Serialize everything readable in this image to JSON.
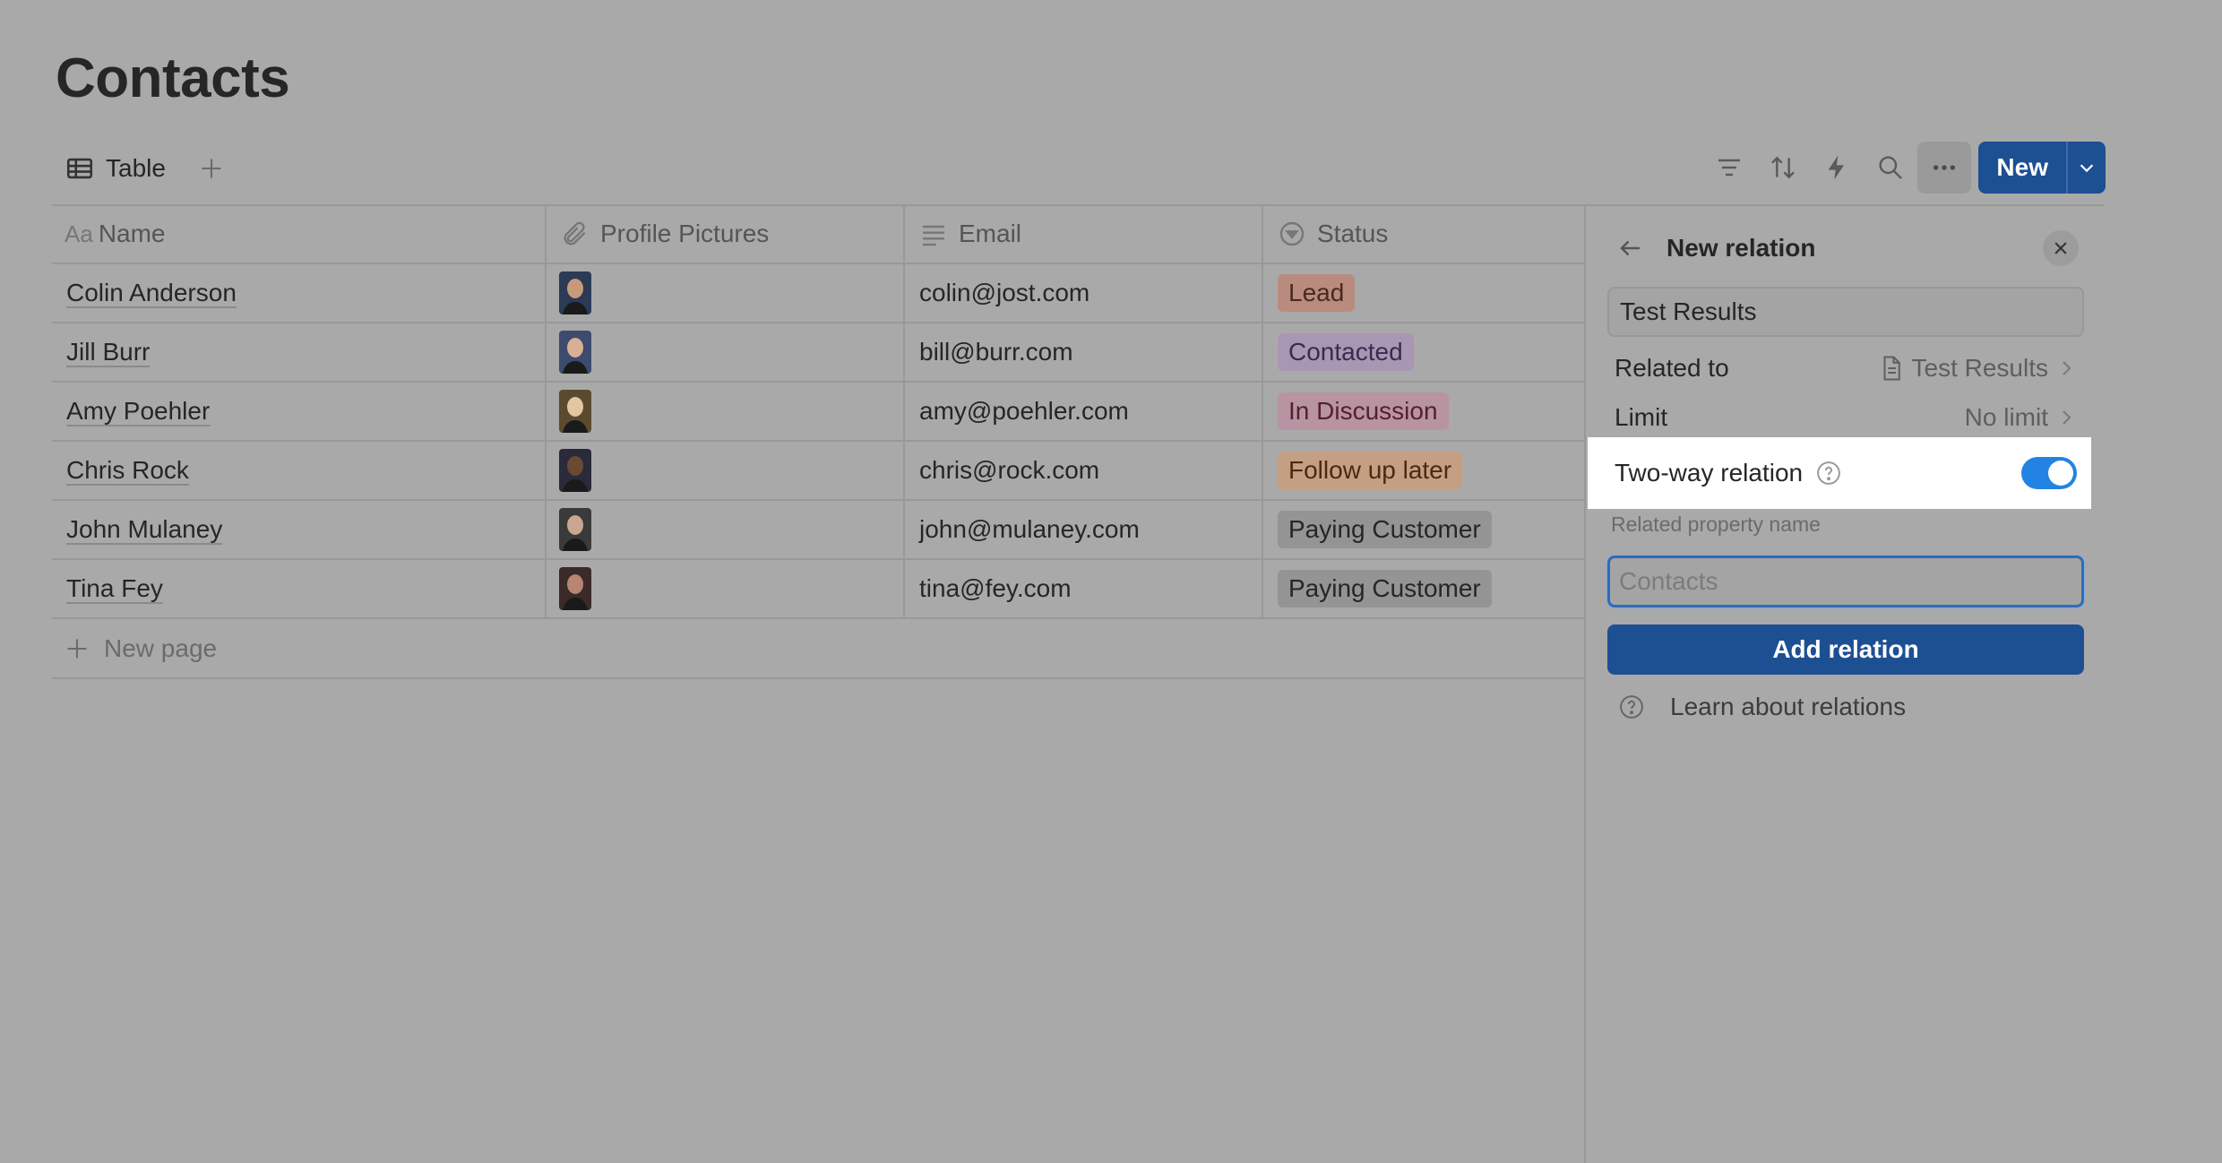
{
  "page": {
    "title": "Contacts"
  },
  "view": {
    "tab_label": "Table"
  },
  "toolbar": {
    "new_label": "New"
  },
  "columns": [
    {
      "label": "Name",
      "icon": "text-icon"
    },
    {
      "label": "Profile Pictures",
      "icon": "paperclip-icon"
    },
    {
      "label": "Email",
      "icon": "text-lines-icon"
    },
    {
      "label": "Status",
      "icon": "status-icon"
    }
  ],
  "rows": [
    {
      "name": "Colin Anderson",
      "email": "colin@jost.com",
      "status": "Lead",
      "status_color": "#b98b7f",
      "status_text": "#4a2a1f"
    },
    {
      "name": "Jill Burr",
      "email": "bill@burr.com",
      "status": "Contacted",
      "status_color": "#a897b3",
      "status_text": "#3e2950"
    },
    {
      "name": "Amy Poehler",
      "email": "amy@poehler.com",
      "status": "In Discussion",
      "status_color": "#b893a2",
      "status_text": "#55202e"
    },
    {
      "name": "Chris Rock",
      "email": "chris@rock.com",
      "status": "Follow up later",
      "status_color": "#c59f82",
      "status_text": "#4a2a12"
    },
    {
      "name": "John Mulaney",
      "email": "john@mulaney.com",
      "status": "Paying Customer",
      "status_color": "#949494",
      "status_text": "#262626"
    },
    {
      "name": "Tina Fey",
      "email": "tina@fey.com",
      "status": "Paying Customer",
      "status_color": "#949494",
      "status_text": "#262626"
    }
  ],
  "new_page_label": "New page",
  "panel": {
    "title": "New relation",
    "name_value": "Test Results",
    "related_to_label": "Related to",
    "related_to_value": "Test Results",
    "limit_label": "Limit",
    "limit_value": "No limit",
    "two_way_label": "Two-way relation",
    "two_way_enabled": true,
    "related_property_label": "Related property name",
    "related_property_placeholder": "Contacts",
    "add_button": "Add relation",
    "learn_link": "Learn about relations"
  },
  "colors": {
    "accent": "#1d4f93",
    "toggle": "#2383e2",
    "overlay": "#a9a9a9"
  }
}
